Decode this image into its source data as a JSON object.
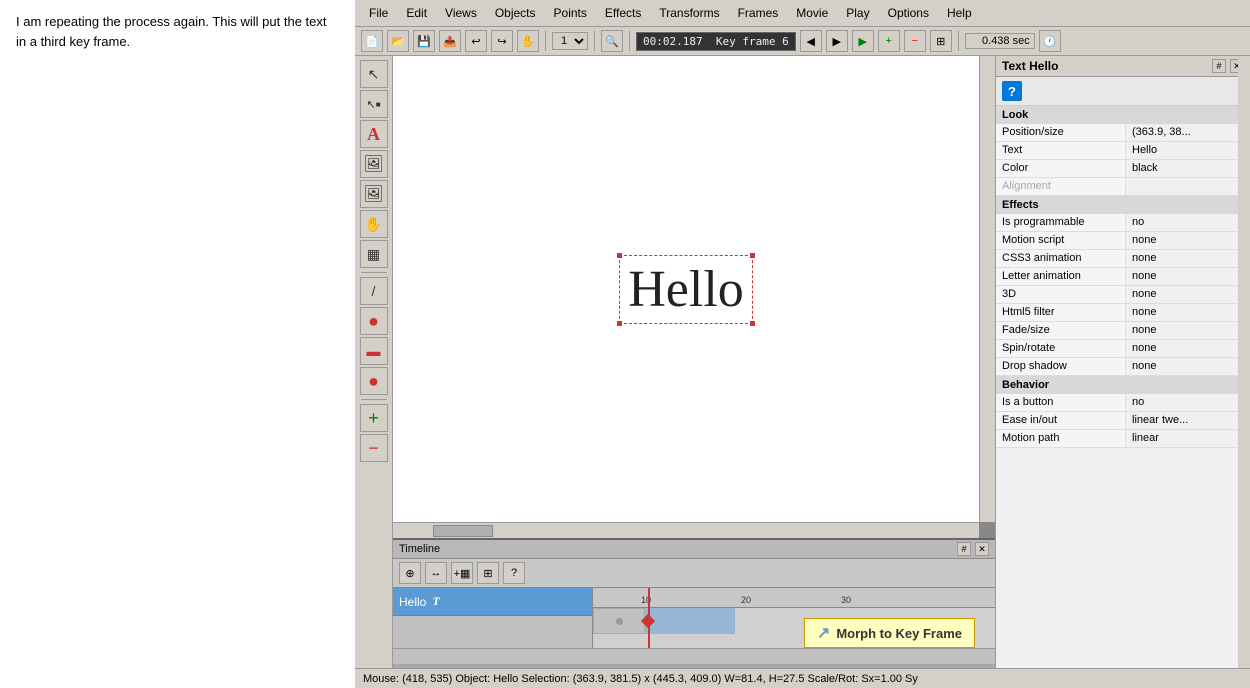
{
  "instruction": {
    "text": "I am repeating the process again. This will put the text in a third key frame."
  },
  "menubar": {
    "items": [
      "File",
      "Edit",
      "Views",
      "Objects",
      "Points",
      "Effects",
      "Transforms",
      "Frames",
      "Movie",
      "Play",
      "Options",
      "Help"
    ]
  },
  "toolbar": {
    "zoom": "1x",
    "timecode": "00:02.187",
    "keyframe_label": "Key frame 6",
    "duration": "0.438 sec"
  },
  "tools": [
    {
      "name": "select",
      "icon": "↖"
    },
    {
      "name": "select-node",
      "icon": "↖·"
    },
    {
      "name": "text",
      "icon": "A"
    },
    {
      "name": "image",
      "icon": "🖼"
    },
    {
      "name": "image2",
      "icon": "🖼"
    },
    {
      "name": "morph",
      "icon": "✋"
    },
    {
      "name": "film",
      "icon": "▦"
    },
    {
      "name": "line",
      "icon": "/"
    },
    {
      "name": "ellipse",
      "icon": "●"
    },
    {
      "name": "rect",
      "icon": "▬"
    },
    {
      "name": "circle2",
      "icon": "●"
    },
    {
      "name": "add",
      "icon": "+"
    },
    {
      "name": "minus",
      "icon": "−"
    }
  ],
  "canvas": {
    "text": "Hello"
  },
  "timeline": {
    "title": "Timeline",
    "track_name": "Hello",
    "ruler_marks": [
      "10",
      "20",
      "30"
    ],
    "morph_tooltip": "Morph to Key Frame"
  },
  "properties_panel": {
    "title": "Text Hello",
    "sections": {
      "look": {
        "label": "Look",
        "rows": [
          {
            "name": "Position/size",
            "value": "(363.9, 38..."
          },
          {
            "name": "Text",
            "value": "Hello"
          },
          {
            "name": "Color",
            "value": "black"
          },
          {
            "name": "Alignment",
            "value": "",
            "greyed": true
          }
        ]
      },
      "effects": {
        "label": "Effects",
        "rows": [
          {
            "name": "Is programmable",
            "value": "no"
          },
          {
            "name": "Motion script",
            "value": "none"
          },
          {
            "name": "CSS3 animation",
            "value": "none"
          },
          {
            "name": "Letter animation",
            "value": "none"
          },
          {
            "name": "3D",
            "value": "none"
          },
          {
            "name": "Html5 filter",
            "value": "none"
          },
          {
            "name": "Fade/size",
            "value": "none"
          },
          {
            "name": "Spin/rotate",
            "value": "none"
          },
          {
            "name": "Drop shadow",
            "value": "none"
          }
        ]
      },
      "behavior": {
        "label": "Behavior",
        "rows": [
          {
            "name": "Is a button",
            "value": "no"
          },
          {
            "name": "Ease in/out",
            "value": "linear twe..."
          },
          {
            "name": "Motion path",
            "value": "linear"
          }
        ]
      }
    }
  },
  "statusbar": {
    "text": "Mouse: (418, 535)  Object: Hello  Selection: (363.9, 381.5) x (445.3, 409.0)  W=81.4,  H=27.5  Scale/Rot: Sx=1.00 Sy"
  }
}
